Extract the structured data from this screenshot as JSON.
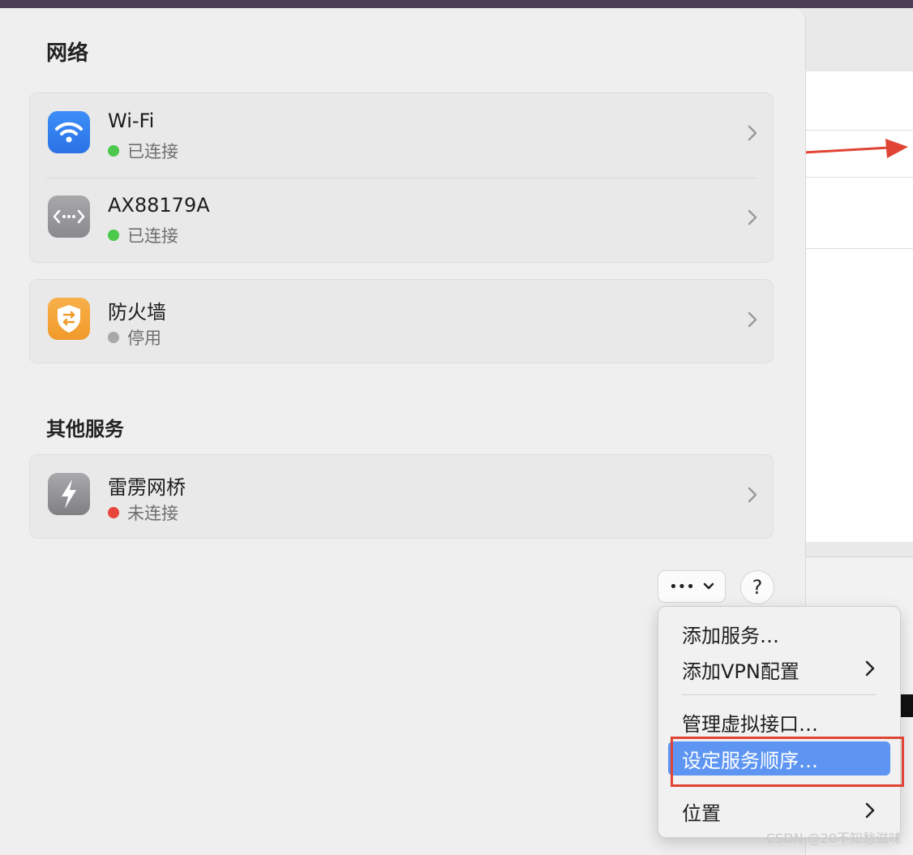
{
  "network": {
    "title": "网络",
    "interfaces": [
      {
        "name": "Wi-Fi",
        "status": "已连接",
        "status_color": "#4cc84a",
        "icon": "wifi-icon"
      },
      {
        "name": "AX88179A",
        "status": "已连接",
        "status_color": "#4cc84a",
        "icon": "ethernet-icon"
      }
    ],
    "firewall": {
      "name": "防火墙",
      "status": "停用",
      "status_color": "#a8a8a8",
      "icon": "firewall-icon"
    }
  },
  "other_services": {
    "title": "其他服务",
    "items": [
      {
        "name": "雷雳网桥",
        "status": "未连接",
        "status_color": "#e8463c",
        "icon": "thunderbolt-icon"
      }
    ]
  },
  "toolbar": {
    "more_label": "•••",
    "help_label": "?"
  },
  "menu": {
    "items": [
      {
        "label": "添加服务…",
        "has_submenu": false
      },
      {
        "label": "添加VPN配置",
        "has_submenu": true
      },
      {
        "label": "管理虚拟接口…",
        "has_submenu": false
      },
      {
        "label": "设定服务顺序…",
        "has_submenu": false,
        "selected": true
      },
      {
        "label": "位置",
        "has_submenu": true
      }
    ]
  },
  "watermark": "CSDN @20不知愁滋味",
  "colors": {
    "accent_selection": "#5e95f2",
    "highlight_box": "#e04434",
    "arrow": "#e04434"
  }
}
